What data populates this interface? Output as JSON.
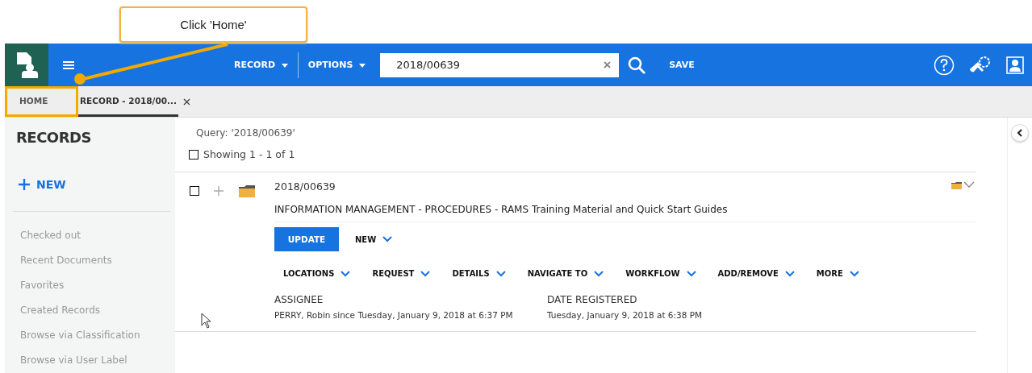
{
  "callout": {
    "text": "Click 'Home'"
  },
  "topbar": {
    "menus": [
      "RECORD",
      "OPTIONS"
    ],
    "search": {
      "value": "2018/00639"
    },
    "save": "SAVE"
  },
  "tabs": [
    {
      "label": "HOME",
      "selected": false,
      "closable": false,
      "highlighted": true
    },
    {
      "label": "RECORD - 2018/00...",
      "selected": true,
      "closable": true,
      "highlighted": false
    }
  ],
  "sidebar": {
    "title": "RECORDS",
    "new": "NEW",
    "items": [
      "Checked out",
      "Recent Documents",
      "Favorites",
      "Created Records",
      "Browse via Classification",
      "Browse via User Label"
    ]
  },
  "results": {
    "query": "Query: '2018/00639'",
    "select_all": {
      "checked": false,
      "label": "Showing 1 - 1 of 1"
    }
  },
  "record": {
    "checked": false,
    "number": "2018/00639",
    "title": "INFORMATION MANAGEMENT - PROCEDURES - RAMS Training Material and Quick Start Guides",
    "update": "UPDATE",
    "new": "NEW",
    "actions": [
      "LOCATIONS",
      "REQUEST",
      "DETAILS",
      "NAVIGATE TO",
      "WORKFLOW",
      "ADD/REMOVE",
      "MORE"
    ],
    "fields": [
      {
        "label": "ASSIGNEE",
        "value": "PERRY, Robin since Tuesday, January 9, 2018 at 6:37 PM"
      },
      {
        "label": "DATE REGISTERED",
        "value": "Tuesday, January 9, 2018 at 6:38 PM"
      }
    ]
  }
}
